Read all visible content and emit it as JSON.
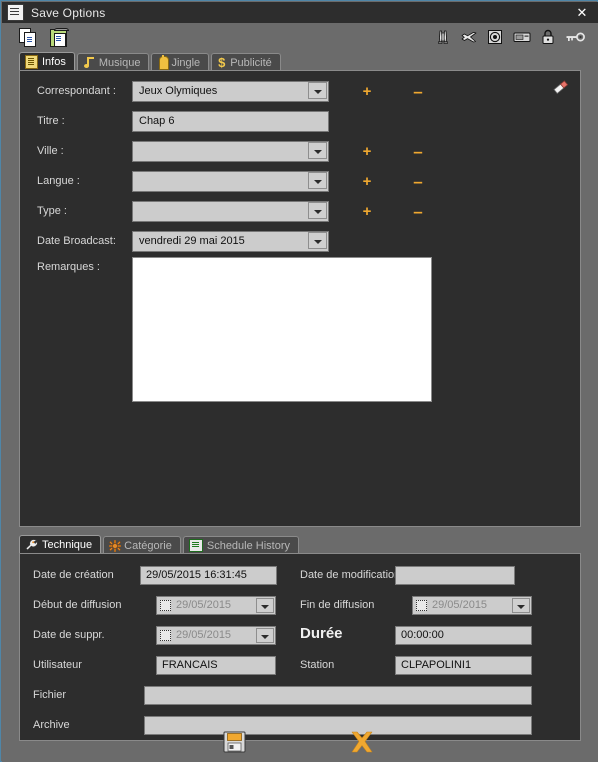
{
  "window": {
    "title": "Save Options",
    "close_label": "✕",
    "title_icon": "document-icon"
  },
  "toolbar": {
    "left_icons": [
      {
        "name": "copy-icon",
        "label": "Copy"
      },
      {
        "name": "paste-icon",
        "label": "Paste"
      }
    ],
    "right_icons": [
      {
        "name": "rocket-icon",
        "label": "Rocket"
      },
      {
        "name": "airplane-icon",
        "label": "Airplane"
      },
      {
        "name": "target-icon",
        "label": "Target"
      },
      {
        "name": "card-icon",
        "label": "Card"
      },
      {
        "name": "lock-icon",
        "label": "Lock"
      },
      {
        "name": "key-icon",
        "label": "Key"
      }
    ]
  },
  "top_tabs": [
    {
      "label": "Infos",
      "icon": "notepad-icon",
      "active": true
    },
    {
      "label": "Musique",
      "icon": "music-note-icon",
      "active": false
    },
    {
      "label": "Jingle",
      "icon": "bell-icon",
      "active": false
    },
    {
      "label": "Publicité",
      "icon": "dollar-icon",
      "active": false
    }
  ],
  "infos": {
    "eraser_icon": "eraser-icon",
    "fields": [
      {
        "label": "Correspondant :",
        "value": "Jeux Olymiques",
        "type": "combo",
        "has_add": true,
        "has_remove": true
      },
      {
        "label": "Titre :",
        "value": "Chap  6",
        "type": "text",
        "has_add": false,
        "has_remove": false
      },
      {
        "label": "Ville :",
        "value": "",
        "type": "combo",
        "has_add": true,
        "has_remove": true
      },
      {
        "label": "Langue :",
        "value": "",
        "type": "combo",
        "has_add": true,
        "has_remove": true
      },
      {
        "label": "Type :",
        "value": "",
        "type": "combo",
        "has_add": true,
        "has_remove": true
      },
      {
        "label": "Date Broadcast:",
        "value": "vendredi 29      mai      2015",
        "type": "combo",
        "has_add": false,
        "has_remove": false
      }
    ],
    "remarks_label": "Remarques :",
    "remarks_value": "",
    "add_label": "+",
    "remove_label": "–"
  },
  "bottom_tabs": [
    {
      "label": "Technique",
      "icon": "wrench-icon",
      "active": true
    },
    {
      "label": "Catégorie",
      "icon": "category-icon",
      "active": false
    },
    {
      "label": "Schedule History",
      "icon": "schedule-icon",
      "active": false
    }
  ],
  "technique": {
    "date_creation_label": "Date de création",
    "date_creation_value": "29/05/2015 16:31:45",
    "date_modification_label": "Date de modification",
    "date_modification_value": "",
    "debut_diffusion_label": "Début de diffusion",
    "debut_diffusion_value": "29/05/2015",
    "fin_diffusion_label": "Fin de diffusion",
    "fin_diffusion_value": "29/05/2015",
    "date_suppr_label": "Date de suppr.",
    "date_suppr_value": "29/05/2015",
    "duree_label": "Durée",
    "duree_value": "00:00:00",
    "utilisateur_label": "Utilisateur",
    "utilisateur_value": "FRANCAIS",
    "station_label": "Station",
    "station_value": "CLPAPOLINI1",
    "fichier_label": "Fichier",
    "fichier_value": "",
    "archive_label": "Archive",
    "archive_value": ""
  },
  "footer": {
    "save_icon": "floppy-save-icon",
    "save_label": "Save",
    "cancel_icon": "cross-cancel-icon",
    "cancel_label": "✕"
  },
  "colors": {
    "accent_orange": "#f0a830",
    "panel_bg": "#2d2d2d",
    "window_bg": "#6b6b6b",
    "field_bg": "#cccccc",
    "border_blue": "#4f86a8"
  }
}
